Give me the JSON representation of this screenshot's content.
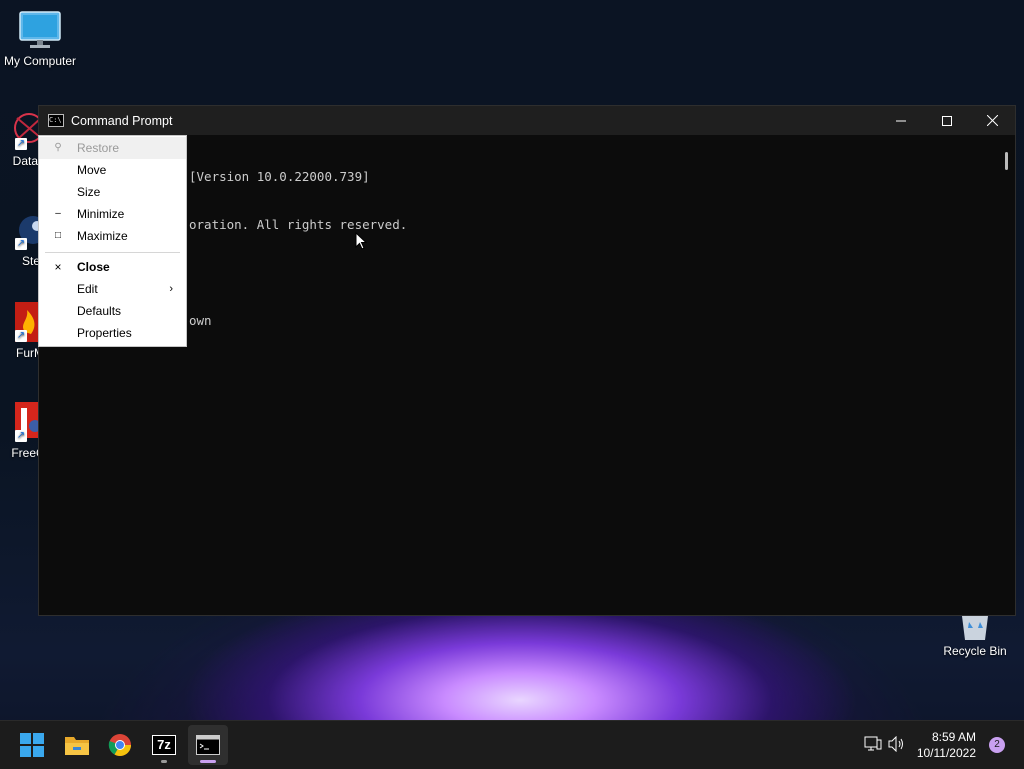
{
  "desktop": {
    "icons": [
      {
        "label": "My Computer"
      },
      {
        "label": "DataW"
      },
      {
        "label": "Ste"
      },
      {
        "label": "FurM"
      },
      {
        "label": "FreeCA"
      },
      {
        "label": "Recycle Bin"
      }
    ]
  },
  "window": {
    "title": "Command Prompt",
    "icon_text": "C:\\",
    "console_lines": [
      "[Version 10.0.22000.739]",
      "oration. All rights reserved.",
      "",
      "own"
    ]
  },
  "menu": {
    "items": [
      {
        "label": "Restore",
        "glyph": "⚲"
      },
      {
        "label": "Move",
        "glyph": ""
      },
      {
        "label": "Size",
        "glyph": ""
      },
      {
        "label": "Minimize",
        "glyph": "–"
      },
      {
        "label": "Maximize",
        "glyph": "□"
      },
      {
        "label": "Close",
        "glyph": "×"
      },
      {
        "label": "Edit",
        "glyph": "",
        "arrow": "›"
      },
      {
        "label": "Defaults",
        "glyph": ""
      },
      {
        "label": "Properties",
        "glyph": ""
      }
    ]
  },
  "taskbar": {
    "apps": [
      "start-icon",
      "file-explorer-icon",
      "chrome-icon",
      "7zip-icon",
      "command-prompt-icon"
    ],
    "sevenzip_text": "7z",
    "time": "8:59 AM",
    "date": "10/11/2022",
    "notifications": "2"
  },
  "colors": {
    "accent": "#c9a0f0",
    "terminal_bg": "#0c0c0c",
    "taskbar_bg": "#1c1c1c"
  }
}
